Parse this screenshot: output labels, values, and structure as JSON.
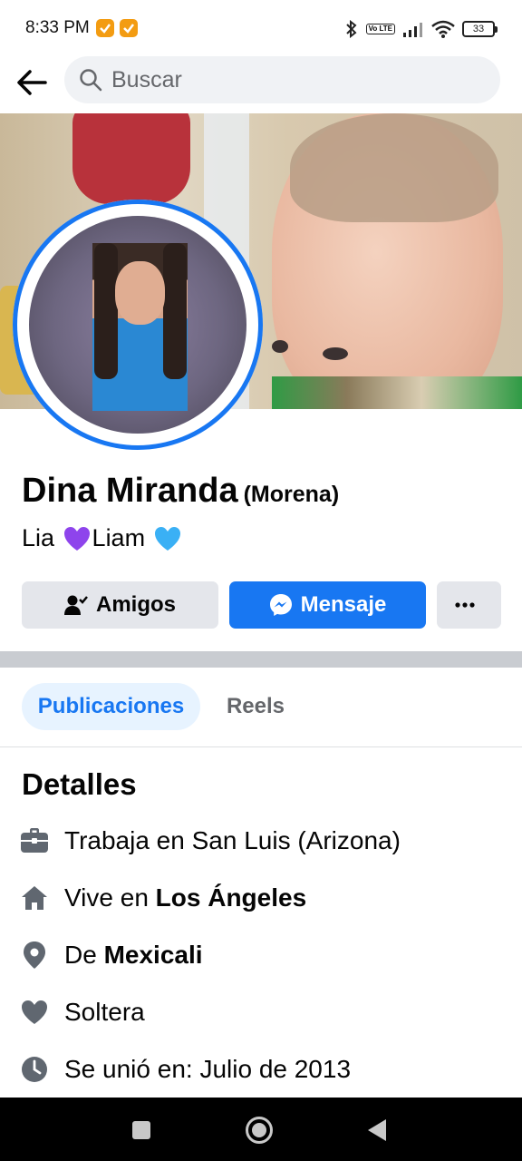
{
  "status_bar": {
    "time": "8:33 PM",
    "volte": "Vo LTE",
    "battery": "33"
  },
  "header": {
    "search_placeholder": "Buscar"
  },
  "profile": {
    "name": "Dina Miranda",
    "alternate_name": "(Morena)",
    "bio_part1": "Lia ",
    "bio_part2": "Liam ",
    "colors": {
      "accent": "#1877f2",
      "purple_heart": "#8e44ec",
      "blue_heart": "#3ab0f5"
    }
  },
  "actions": {
    "friends_label": "Amigos",
    "message_label": "Mensaje",
    "more_label": "···"
  },
  "tabs": [
    {
      "label": "Publicaciones",
      "active": true
    },
    {
      "label": "Reels",
      "active": false
    }
  ],
  "details": {
    "title": "Detalles",
    "items": [
      {
        "icon": "briefcase-icon",
        "text": "Trabaja en San Luis (Arizona)",
        "bold": ""
      },
      {
        "icon": "home-icon",
        "text": "Vive en ",
        "bold": "Los Ángeles"
      },
      {
        "icon": "location-pin-icon",
        "text": "De ",
        "bold": "Mexicali"
      },
      {
        "icon": "heart-icon",
        "text": "Soltera",
        "bold": ""
      },
      {
        "icon": "clock-icon",
        "text": "Se unió en: Julio de 2013",
        "bold": ""
      }
    ]
  }
}
